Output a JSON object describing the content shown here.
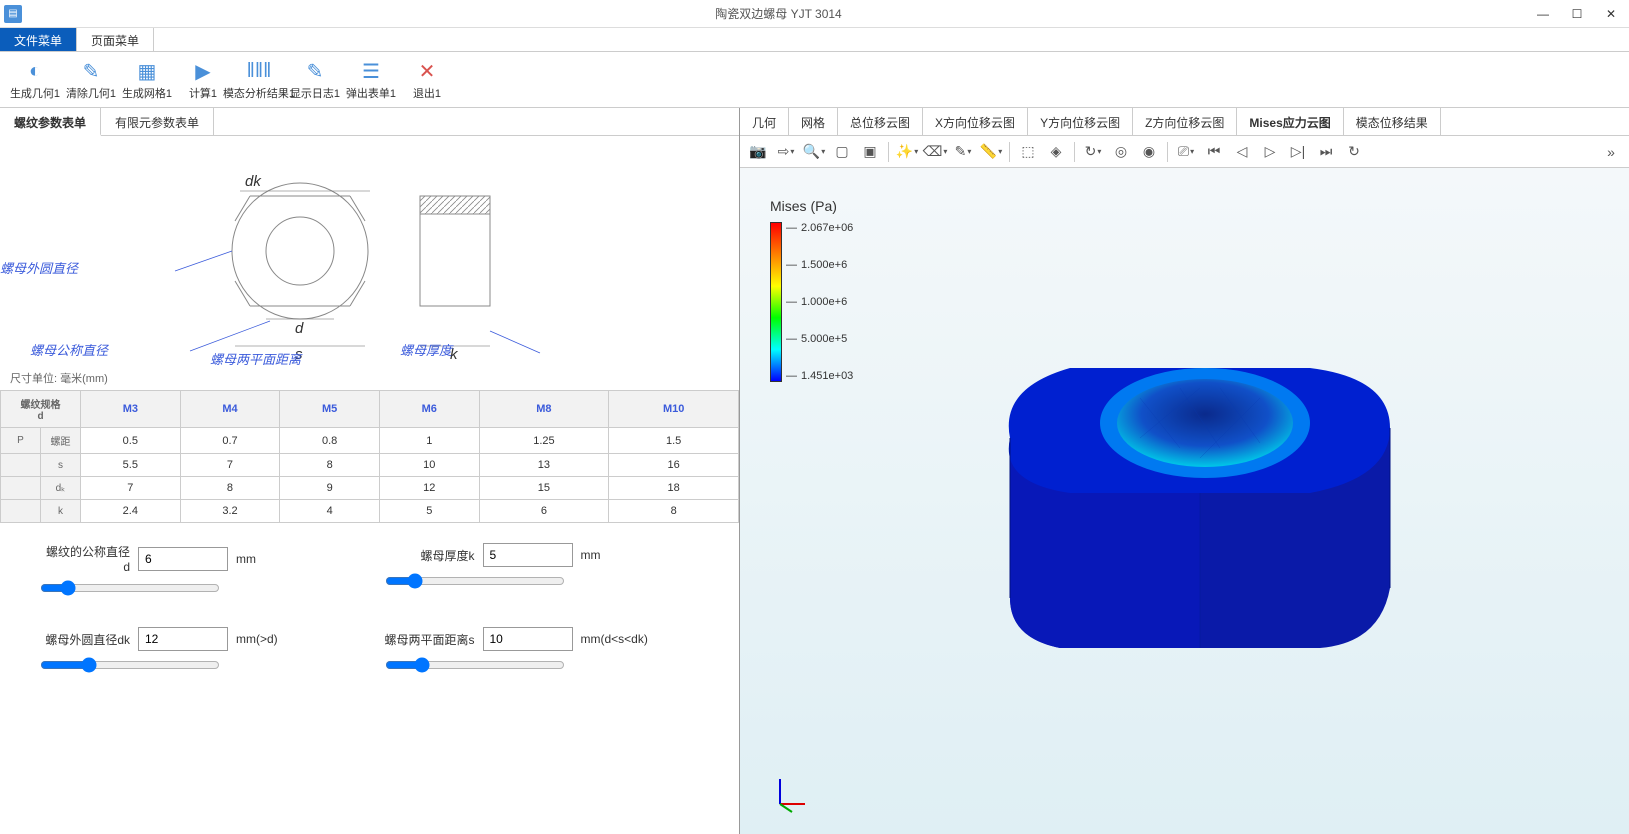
{
  "window": {
    "title": "陶瓷双边螺母 YJT 3014"
  },
  "menus": {
    "file": "文件菜单",
    "page": "页面菜单"
  },
  "ribbon": [
    {
      "id": "gen-geom",
      "label": "生成几何1",
      "glyph": "◐"
    },
    {
      "id": "clear-geom",
      "label": "清除几何1",
      "glyph": "✎"
    },
    {
      "id": "gen-mesh",
      "label": "生成网格1",
      "glyph": "▦"
    },
    {
      "id": "compute",
      "label": "计算1",
      "glyph": "▶"
    },
    {
      "id": "modal",
      "label": "模态分析结果1",
      "glyph": "ǁǁǁ"
    },
    {
      "id": "show-log",
      "label": "显示日志1",
      "glyph": "✎"
    },
    {
      "id": "popup-form",
      "label": "弹出表单1",
      "glyph": "☰"
    },
    {
      "id": "exit",
      "label": "退出1",
      "glyph": "✕"
    }
  ],
  "left_tabs": [
    "螺纹参数表单",
    "有限元参数表单"
  ],
  "left_tab_active": 0,
  "diagram_labels": {
    "outer_dia": "螺母外圆直径",
    "nominal_dia": "螺母公称直径",
    "flat_dist": "螺母两平面距离",
    "thickness": "螺母厚度",
    "dk": "dk",
    "d": "d",
    "s": "s",
    "k": "k"
  },
  "unit_note": "尺寸单位: 毫米(mm)",
  "spec_table": {
    "header_left": "螺纹规格\nd",
    "columns": [
      "M3",
      "M4",
      "M5",
      "M6",
      "M8",
      "M10"
    ],
    "rows": [
      {
        "side": "P",
        "sub": "螺距",
        "vals": [
          "0.5",
          "0.7",
          "0.8",
          "1",
          "1.25",
          "1.5"
        ]
      },
      {
        "side": "",
        "sub": "s",
        "vals": [
          "5.5",
          "7",
          "8",
          "10",
          "13",
          "16"
        ]
      },
      {
        "side": "",
        "sub": "dₖ",
        "vals": [
          "7",
          "8",
          "9",
          "12",
          "15",
          "18"
        ]
      },
      {
        "side": "",
        "sub": "k",
        "vals": [
          "2.4",
          "3.2",
          "4",
          "5",
          "6",
          "8"
        ]
      }
    ]
  },
  "params": {
    "d": {
      "label": "螺纹的公称直径d",
      "value": "6",
      "unit": "mm"
    },
    "k": {
      "label": "螺母厚度k",
      "value": "5",
      "unit": "mm"
    },
    "dk": {
      "label": "螺母外圆直径dk",
      "value": "12",
      "unit": "mm(>d)"
    },
    "s": {
      "label": "螺母两平面距离s",
      "value": "10",
      "unit": "mm(d<s<dk)"
    }
  },
  "right_tabs": [
    "几何",
    "网格",
    "总位移云图",
    "X方向位移云图",
    "Y方向位移云图",
    "Z方向位移云图",
    "Mises应力云图",
    "模态位移结果"
  ],
  "right_tab_active": 6,
  "r_toolbar_icons": [
    {
      "name": "camera-icon",
      "glyph": "📷"
    },
    {
      "name": "export-icon",
      "glyph": "⇨",
      "dd": true
    },
    {
      "name": "zoom-icon",
      "glyph": "🔍",
      "dd": true
    },
    {
      "name": "box1-icon",
      "glyph": "▢"
    },
    {
      "name": "box2-icon",
      "glyph": "▣"
    },
    {
      "name": "sep"
    },
    {
      "name": "wand-icon",
      "glyph": "✨",
      "dd": true
    },
    {
      "name": "clear-icon",
      "glyph": "⌫",
      "dd": true
    },
    {
      "name": "brush-icon",
      "glyph": "✎",
      "dd": true
    },
    {
      "name": "ruler-icon",
      "glyph": "📏",
      "dd": true
    },
    {
      "name": "sep"
    },
    {
      "name": "select-icon",
      "glyph": "⬚"
    },
    {
      "name": "target-icon",
      "glyph": "◈"
    },
    {
      "name": "sep"
    },
    {
      "name": "rotate-icon",
      "glyph": "↻",
      "dd": true
    },
    {
      "name": "orbit1-icon",
      "glyph": "◎"
    },
    {
      "name": "orbit2-icon",
      "glyph": "◉"
    },
    {
      "name": "sep"
    },
    {
      "name": "record-icon",
      "glyph": "⎚",
      "dd": true
    },
    {
      "name": "first-icon",
      "glyph": "⏮"
    },
    {
      "name": "prev-icon",
      "glyph": "◁"
    },
    {
      "name": "play-icon",
      "glyph": "▷"
    },
    {
      "name": "next-icon",
      "glyph": "▷|"
    },
    {
      "name": "last-icon",
      "glyph": "⏭"
    },
    {
      "name": "loop-icon",
      "glyph": "↻"
    }
  ],
  "legend": {
    "title": "Mises (Pa)",
    "ticks": [
      "2.067e+06",
      "1.500e+6",
      "1.000e+6",
      "5.000e+5",
      "1.451e+03"
    ]
  }
}
